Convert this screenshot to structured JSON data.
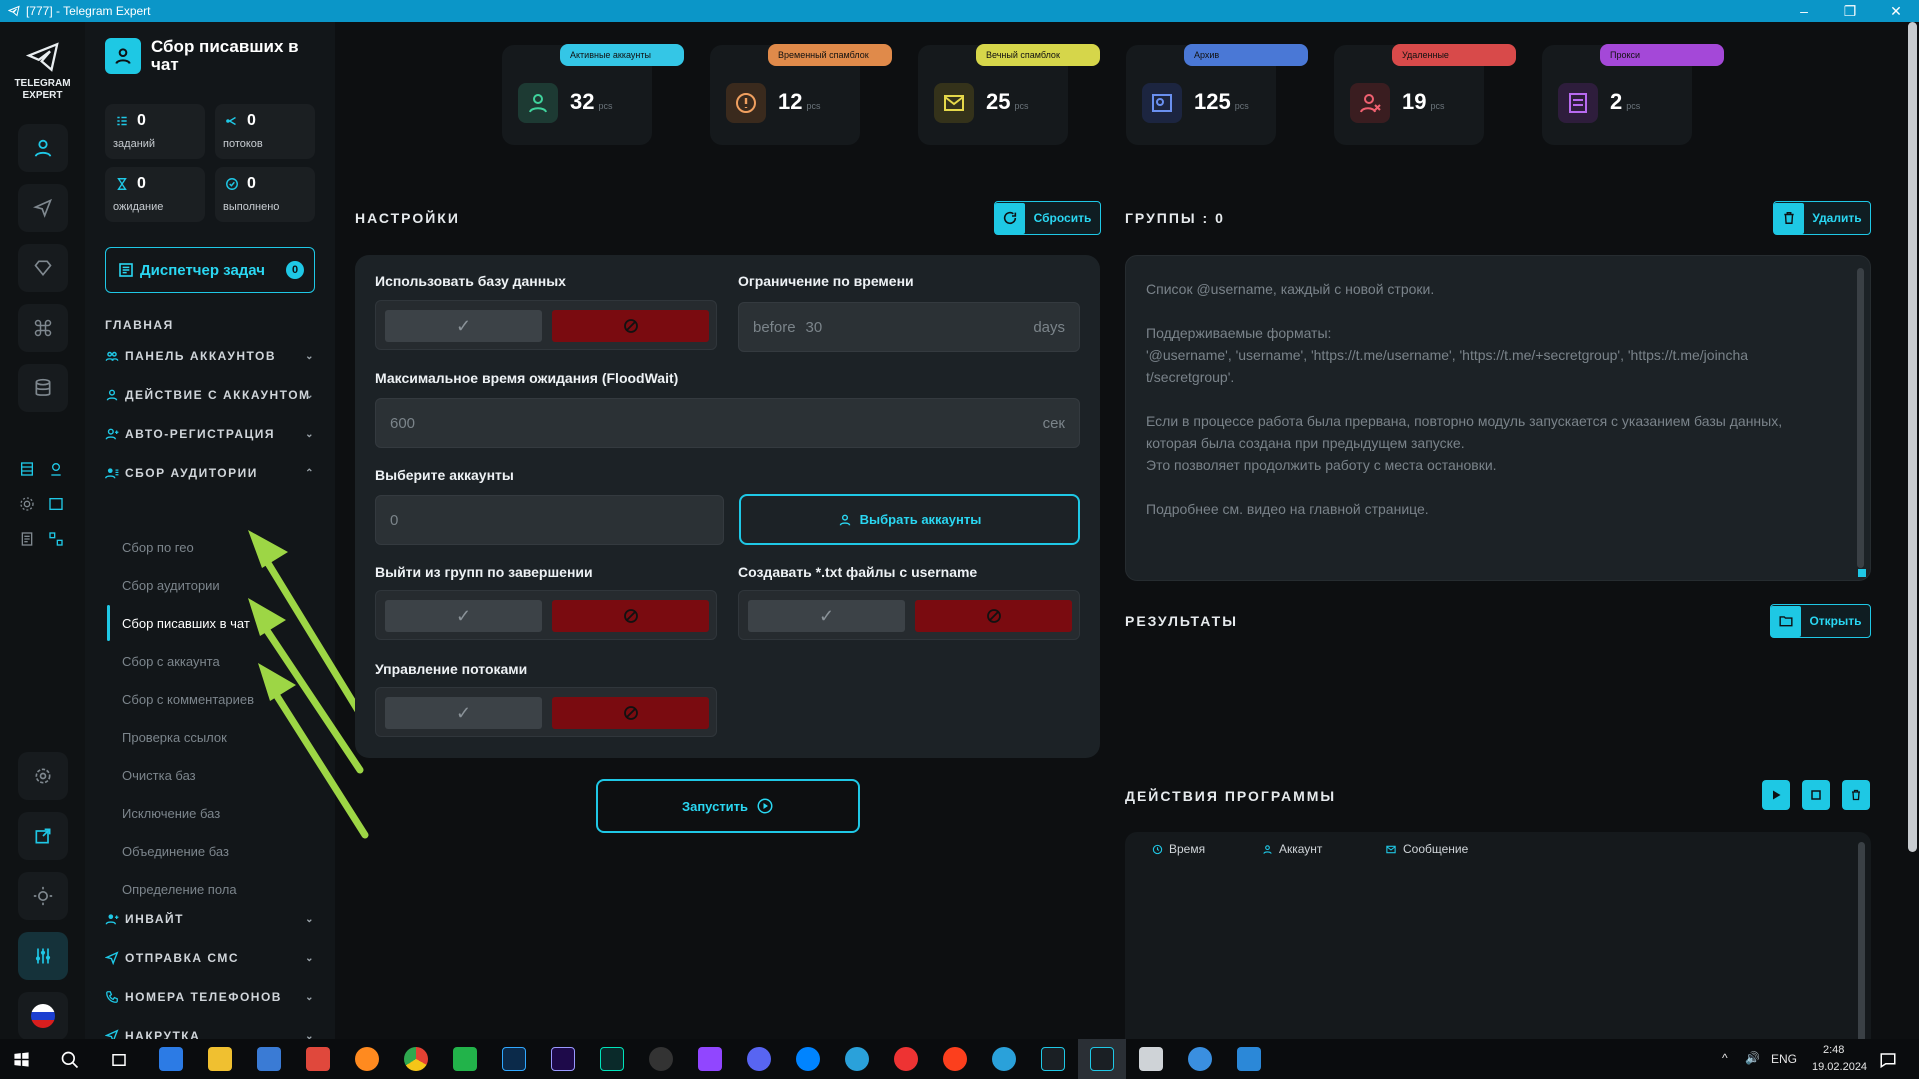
{
  "window": {
    "title": "[777] - Telegram Expert",
    "minimize": "–",
    "maximize": "❐",
    "close": "✕"
  },
  "logo": {
    "line1": "TELEGRAM",
    "line2": "EXPERT"
  },
  "page": {
    "title": "Сбор писавших в чат"
  },
  "stats": [
    {
      "value": "0",
      "label": "заданий",
      "icon": "list-icon"
    },
    {
      "value": "0",
      "label": "потоков",
      "icon": "flow-icon"
    },
    {
      "value": "0",
      "label": "ожидание",
      "icon": "hourglass-icon"
    },
    {
      "value": "0",
      "label": "выполнено",
      "icon": "check-circle-icon"
    }
  ],
  "dispatcher": {
    "label": "Диспетчер задач",
    "count": "0"
  },
  "nav": {
    "main": "ГЛАВНАЯ",
    "sections": [
      {
        "label": "ПАНЕЛЬ АККАУНТОВ",
        "chev": "⌄"
      },
      {
        "label": "ДЕЙСТВИЕ С АККАУНТОМ",
        "chev": "⌄"
      },
      {
        "label": "АВТО-РЕГИСТРАЦИЯ",
        "chev": "⌄"
      },
      {
        "label": "СБОР АУДИТОРИИ",
        "chev": "⌃"
      }
    ],
    "sub": [
      "Сбор по гео",
      "Сбор аудитории",
      "Сбор писавших в чат",
      "Сбор с аккаунта",
      "Сбор с комментариев",
      "Проверка ссылок",
      "Очистка баз",
      "Исключение баз",
      "Объединение баз",
      "Определение пола"
    ],
    "after": [
      {
        "label": "ИНВАЙТ",
        "chev": "⌄"
      },
      {
        "label": "ОТПРАВКА СМС",
        "chev": "⌄"
      },
      {
        "label": "НОМЕРА ТЕЛЕФОНОВ",
        "chev": "⌄"
      },
      {
        "label": "НАКРУТКА",
        "chev": "⌄"
      }
    ]
  },
  "cards": [
    {
      "label": "Активные аккаунты",
      "value": "32",
      "unit": "pcs",
      "color": "#34c6e6",
      "icon_bg": "#1d3a33",
      "icon_color": "#3fd39c"
    },
    {
      "label": "Временный спамблок",
      "value": "12",
      "unit": "pcs",
      "color": "#e08a4a",
      "icon_bg": "#3a2a1d",
      "icon_color": "#f0a060"
    },
    {
      "label": "Вечный спамблок",
      "value": "25",
      "unit": "pcs",
      "color": "#d6d64a",
      "icon_bg": "#34321a",
      "icon_color": "#e5d84a"
    },
    {
      "label": "Архив",
      "value": "125",
      "unit": "pcs",
      "color": "#4a78d6",
      "icon_bg": "#1c2540",
      "icon_color": "#6a90f0"
    },
    {
      "label": "Удаленные",
      "value": "19",
      "unit": "pcs",
      "color": "#d84a4a",
      "icon_bg": "#3a1d20",
      "icon_color": "#f06070"
    },
    {
      "label": "Прокси",
      "value": "2",
      "unit": "pcs",
      "color": "#a448d8",
      "icon_bg": "#2e1d3c",
      "icon_color": "#b86af0"
    }
  ],
  "settings": {
    "header": "НАСТРОЙКИ",
    "reset": "Сбросить",
    "use_db": "Использовать базу данных",
    "time_limit": "Ограничение по времени",
    "time_prefix": "before",
    "time_value": "30",
    "time_suffix": "days",
    "floodwait": "Максимальное время ожидания (FloodWait)",
    "floodwait_value": "600",
    "floodwait_suffix": "сек",
    "choose_accounts": "Выберите аккаунты",
    "accounts_value": "0",
    "choose_btn": "Выбрать аккаунты",
    "leave_groups": "Выйти из групп по завершении",
    "create_txt": "Создавать *.txt файлы с username",
    "threads": "Управление потоками",
    "run": "Запустить",
    "check": "✓"
  },
  "groups": {
    "header": "ГРУППЫ : 0",
    "delete": "Удалить",
    "lines": [
      "Список @username, каждый с новой строки.",
      "",
      "Поддерживаемые форматы:",
      "'@username', 'username', 'https://t.me/username', 'https://t.me/+secretgroup', 'https://t.me/joincha",
      "t/secretgroup'.",
      "",
      "Если в процессе работа была прервана, повторно модуль запускается с указанием базы данных,",
      "которая была создана при предыдущем запуске.",
      "Это позволяет продолжить работу с места остановки.",
      "",
      "Подробнее см. видео на главной странице."
    ]
  },
  "results": {
    "header": "РЕЗУЛЬТАТЫ",
    "open": "Открыть"
  },
  "log": {
    "header": "ДЕЙСТВИЯ ПРОГРАММЫ",
    "cols": [
      "Время",
      "Аккаунт",
      "Сообщение"
    ]
  },
  "taskbar": {
    "lang": "ENG",
    "time": "2:48",
    "date": "19.02.2024",
    "tray_arrow": "^",
    "volume": "🔊"
  }
}
